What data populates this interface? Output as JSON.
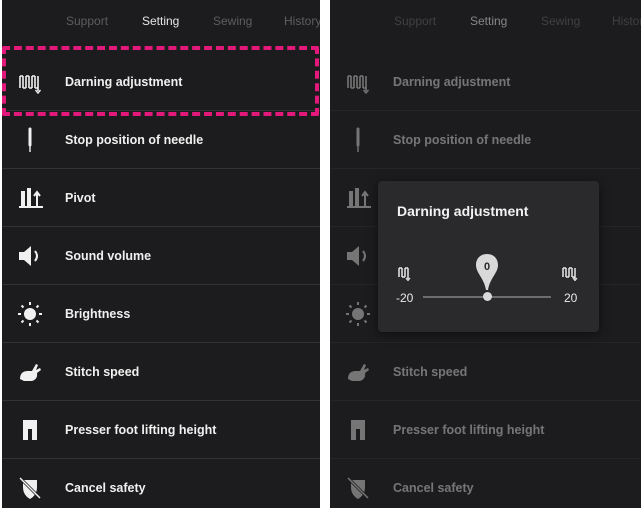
{
  "tabs": [
    "Support",
    "Setting",
    "Sewing",
    "History"
  ],
  "active_tab": "Setting",
  "menu": [
    {
      "label": "Darning adjustment",
      "icon": "darning-icon"
    },
    {
      "label": "Stop position of needle",
      "icon": "needle-icon"
    },
    {
      "label": "Pivot",
      "icon": "pivot-icon"
    },
    {
      "label": "Sound volume",
      "icon": "speaker-icon"
    },
    {
      "label": "Brightness",
      "icon": "sun-icon"
    },
    {
      "label": "Stitch speed",
      "icon": "rabbit-icon"
    },
    {
      "label": "Presser foot lifting height",
      "icon": "presser-foot-icon"
    },
    {
      "label": "Cancel safety",
      "icon": "cancel-safety-icon"
    }
  ],
  "dialog": {
    "title": "Darning adjustment",
    "min_label": "-20",
    "max_label": "20",
    "value": "0",
    "slider_min": -20,
    "slider_max": 20,
    "slider_value": 0
  },
  "colors": {
    "panel_bg": "#1c1c1e",
    "highlight": "#e2197a",
    "dialog_bg": "#2a2a2d"
  }
}
